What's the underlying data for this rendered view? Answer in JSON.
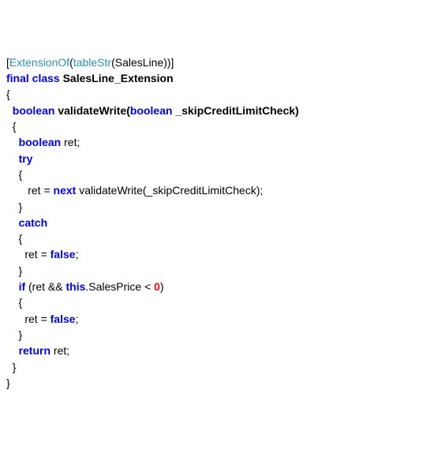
{
  "code": {
    "tokens": [
      [
        {
          "t": "[",
          "c": "plain"
        },
        {
          "t": "ExtensionOf",
          "c": "type"
        },
        {
          "t": "(",
          "c": "plain"
        },
        {
          "t": "tableStr",
          "c": "type"
        },
        {
          "t": "(SalesLine))]",
          "c": "plain"
        }
      ],
      [
        {
          "t": "final class",
          "c": "kw-bold"
        },
        {
          "t": " SalesLine_Extension",
          "c": "plain bold"
        }
      ],
      [
        {
          "t": "{",
          "c": "plain"
        }
      ],
      [
        {
          "t": "  ",
          "c": "plain"
        },
        {
          "t": "boolean",
          "c": "kw-bold"
        },
        {
          "t": " validateWrite(",
          "c": "plain bold"
        },
        {
          "t": "boolean",
          "c": "kw-bold"
        },
        {
          "t": " _skipCreditLimitCheck)",
          "c": "plain bold"
        }
      ],
      [
        {
          "t": "  {",
          "c": "plain"
        }
      ],
      [
        {
          "t": "    ",
          "c": "plain"
        },
        {
          "t": "boolean",
          "c": "kw-bold"
        },
        {
          "t": " ret;",
          "c": "plain"
        }
      ],
      [
        {
          "t": "    ",
          "c": "plain"
        },
        {
          "t": "try",
          "c": "kw-bold"
        }
      ],
      [
        {
          "t": "    {",
          "c": "plain"
        }
      ],
      [
        {
          "t": "       ret = ",
          "c": "plain"
        },
        {
          "t": "next",
          "c": "kw-bold"
        },
        {
          "t": " validateWrite(_skipCreditLimitCheck);",
          "c": "plain"
        }
      ],
      [
        {
          "t": "    }",
          "c": "plain"
        }
      ],
      [
        {
          "t": "    ",
          "c": "plain"
        },
        {
          "t": "catch",
          "c": "kw-bold"
        }
      ],
      [
        {
          "t": "    {",
          "c": "plain"
        }
      ],
      [
        {
          "t": "      ret = ",
          "c": "plain"
        },
        {
          "t": "false",
          "c": "kw-bold"
        },
        {
          "t": ";",
          "c": "plain"
        }
      ],
      [
        {
          "t": "    }",
          "c": "plain"
        }
      ],
      [
        {
          "t": "    ",
          "c": "plain"
        },
        {
          "t": "if",
          "c": "kw-bold"
        },
        {
          "t": " (ret && ",
          "c": "plain"
        },
        {
          "t": "this",
          "c": "kw-bold"
        },
        {
          "t": ".SalesPrice < ",
          "c": "plain"
        },
        {
          "t": "0",
          "c": "num"
        },
        {
          "t": ")",
          "c": "plain"
        }
      ],
      [
        {
          "t": "    {",
          "c": "plain"
        }
      ],
      [
        {
          "t": "      ret = ",
          "c": "plain"
        },
        {
          "t": "false",
          "c": "kw-bold"
        },
        {
          "t": ";",
          "c": "plain"
        }
      ],
      [
        {
          "t": "    }",
          "c": "plain"
        }
      ],
      [
        {
          "t": "    ",
          "c": "plain"
        },
        {
          "t": "return",
          "c": "kw-bold"
        },
        {
          "t": " ret;",
          "c": "plain"
        }
      ],
      [
        {
          "t": "  }",
          "c": "plain"
        }
      ],
      [
        {
          "t": "}",
          "c": "plain"
        }
      ]
    ]
  }
}
